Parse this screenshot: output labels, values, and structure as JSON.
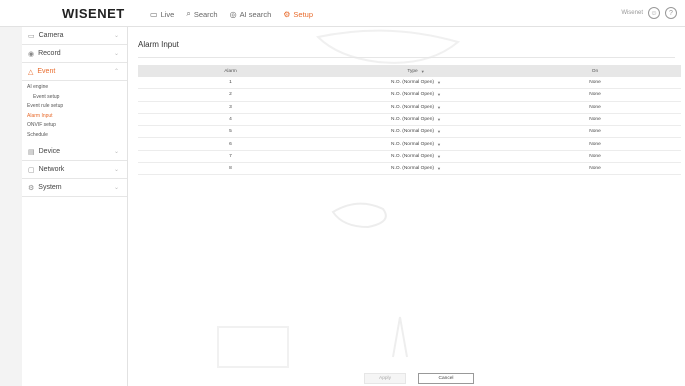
{
  "header": {
    "logo": "WISENET",
    "nav": [
      {
        "icon": "live-icon",
        "label": "Live",
        "glyph": "▭"
      },
      {
        "icon": "search-icon",
        "label": "Search",
        "glyph": "⌕"
      },
      {
        "icon": "ai-search-icon",
        "label": "AI search",
        "glyph": "◎"
      },
      {
        "icon": "setup-icon",
        "label": "Setup",
        "glyph": "⚙"
      }
    ],
    "user_label": "Wisenet",
    "accent_color": "#e86b2c"
  },
  "sidebar": {
    "menus": [
      {
        "icon": "camera-icon",
        "glyph": "▭",
        "label": "Camera"
      },
      {
        "icon": "record-icon",
        "glyph": "◉",
        "label": "Record"
      },
      {
        "icon": "event-icon",
        "glyph": "△",
        "label": "Event"
      },
      {
        "icon": "device-icon",
        "glyph": "▤",
        "label": "Device"
      },
      {
        "icon": "network-icon",
        "glyph": "▢",
        "label": "Network"
      },
      {
        "icon": "system-icon",
        "glyph": "⚙",
        "label": "System"
      }
    ],
    "event_sub": [
      {
        "label": "AI engine",
        "indent": false,
        "active": false
      },
      {
        "label": "Event setup",
        "indent": true,
        "active": false
      },
      {
        "label": "Event rule setup",
        "indent": false,
        "active": false
      },
      {
        "label": "Alarm Input",
        "indent": false,
        "active": true
      },
      {
        "label": "ONVIF setup",
        "indent": false,
        "active": false
      },
      {
        "label": "Schedule",
        "indent": false,
        "active": false
      }
    ]
  },
  "main": {
    "title": "Alarm Input",
    "columns": [
      "Alarm",
      "Type",
      "On"
    ],
    "rows": [
      {
        "alarm": "1",
        "type": "N.O. (Normal Open)",
        "on": "None"
      },
      {
        "alarm": "2",
        "type": "N.O. (Normal Open)",
        "on": "None"
      },
      {
        "alarm": "3",
        "type": "N.O. (Normal Open)",
        "on": "None"
      },
      {
        "alarm": "4",
        "type": "N.O. (Normal Open)",
        "on": "None"
      },
      {
        "alarm": "5",
        "type": "N.O. (Normal Open)",
        "on": "None"
      },
      {
        "alarm": "6",
        "type": "N.O. (Normal Open)",
        "on": "None"
      },
      {
        "alarm": "7",
        "type": "N.O. (Normal Open)",
        "on": "None"
      },
      {
        "alarm": "8",
        "type": "N.O. (Normal Open)",
        "on": "None"
      }
    ],
    "apply_label": "Apply",
    "cancel_label": "Cancel"
  }
}
